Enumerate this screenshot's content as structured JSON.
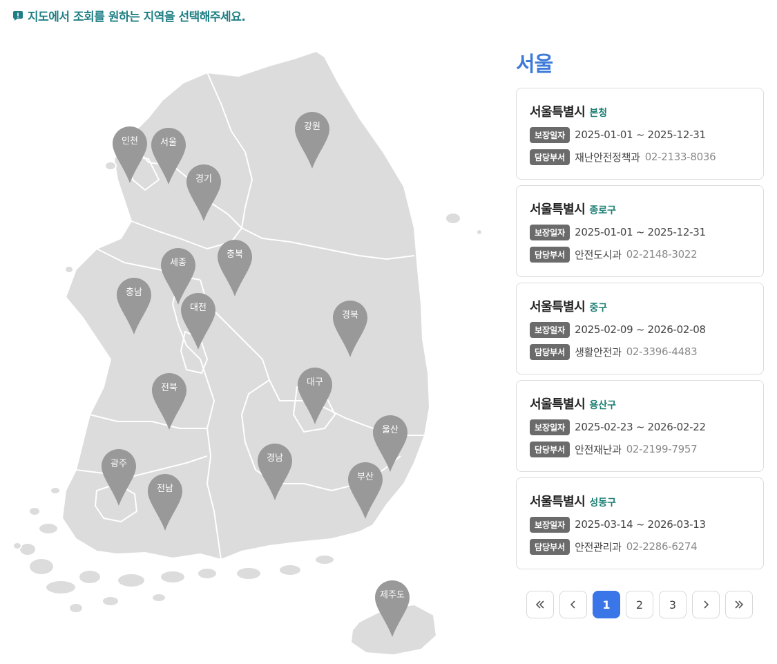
{
  "notice": {
    "text": "지도에서 조회를 원하는 지역을 선택해주세요."
  },
  "map": {
    "pins": [
      {
        "label": "인천"
      },
      {
        "label": "서울"
      },
      {
        "label": "강원"
      },
      {
        "label": "경기"
      },
      {
        "label": "세종"
      },
      {
        "label": "충북"
      },
      {
        "label": "충남"
      },
      {
        "label": "대전"
      },
      {
        "label": "경북"
      },
      {
        "label": "대구"
      },
      {
        "label": "전북"
      },
      {
        "label": "울산"
      },
      {
        "label": "광주"
      },
      {
        "label": "경남"
      },
      {
        "label": "부산"
      },
      {
        "label": "전남"
      },
      {
        "label": "제주도"
      }
    ]
  },
  "detail": {
    "title": "서울",
    "date_tag": "보장일자",
    "dept_tag": "담당부서",
    "cards": [
      {
        "name": "서울특별시",
        "sub": "본청",
        "period": "2025-01-01 ~ 2025-12-31",
        "dept": "재난안전정책과",
        "phone": "02-2133-8036"
      },
      {
        "name": "서울특별시",
        "sub": "종로구",
        "period": "2025-01-01 ~ 2025-12-31",
        "dept": "안전도시과",
        "phone": "02-2148-3022"
      },
      {
        "name": "서울특별시",
        "sub": "중구",
        "period": "2025-02-09 ~ 2026-02-08",
        "dept": "생활안전과",
        "phone": "02-3396-4483"
      },
      {
        "name": "서울특별시",
        "sub": "용산구",
        "period": "2025-02-23 ~ 2026-02-22",
        "dept": "안전재난과",
        "phone": "02-2199-7957"
      },
      {
        "name": "서울특별시",
        "sub": "성동구",
        "period": "2025-03-14 ~ 2026-03-13",
        "dept": "안전관리과",
        "phone": "02-2286-6274"
      }
    ]
  },
  "pagination": {
    "pages": [
      "1",
      "2",
      "3"
    ],
    "current": "1"
  },
  "colors": {
    "pin": "#999999",
    "land": "#dcdcdc",
    "accent": "#3b76e8",
    "notice": "#1f7f84"
  }
}
